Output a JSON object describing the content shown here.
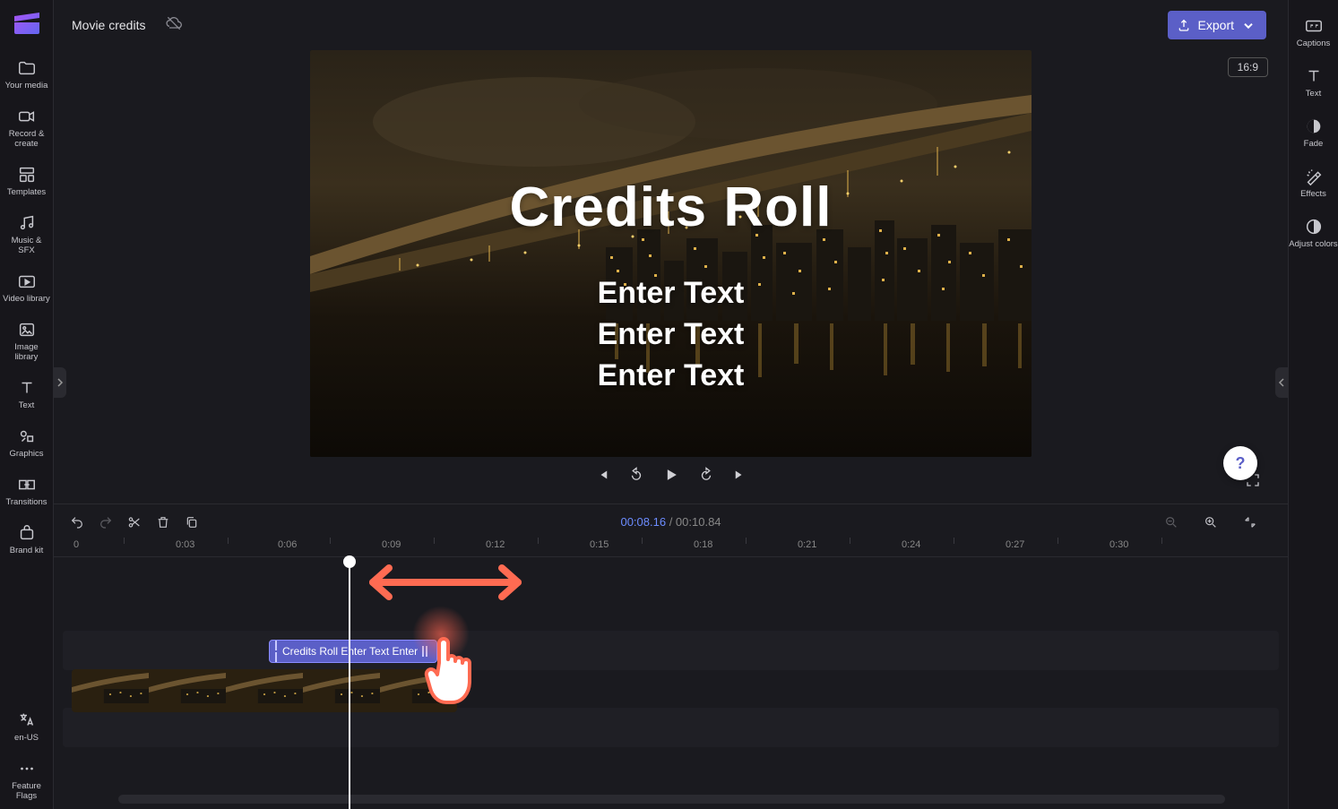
{
  "project": {
    "title": "Movie credits"
  },
  "export": {
    "label": "Export"
  },
  "aspect": {
    "label": "16:9"
  },
  "left_sidebar": {
    "your_media": "Your media",
    "record_create": "Record & create",
    "templates": "Templates",
    "music_sfx": "Music & SFX",
    "video_library": "Video library",
    "image_library": "Image library",
    "text": "Text",
    "graphics": "Graphics",
    "transitions": "Transitions",
    "brand_kit": "Brand kit",
    "locale": "en-US",
    "feature_flags": "Feature Flags"
  },
  "right_sidebar": {
    "captions": "Captions",
    "text": "Text",
    "fade": "Fade",
    "effects": "Effects",
    "adjust_colors": "Adjust colors"
  },
  "preview": {
    "credits_title": "Credits Roll",
    "line1": "Enter Text",
    "line2": "Enter Text",
    "line3": "Enter Text"
  },
  "playback": {
    "current_time": "00:08.16",
    "separator": " / ",
    "duration": "00:10.84"
  },
  "ruler": {
    "t0": "0",
    "t03": "0:03",
    "t06": "0:06",
    "t09": "0:09",
    "t12": "0:12",
    "t15": "0:15",
    "t18": "0:18",
    "t21": "0:21",
    "t24": "0:24",
    "t27": "0:27",
    "t30": "0:30"
  },
  "clips": {
    "text_clip_label": "Credits Roll Enter Text Enter"
  },
  "help": {
    "glyph": "?"
  }
}
